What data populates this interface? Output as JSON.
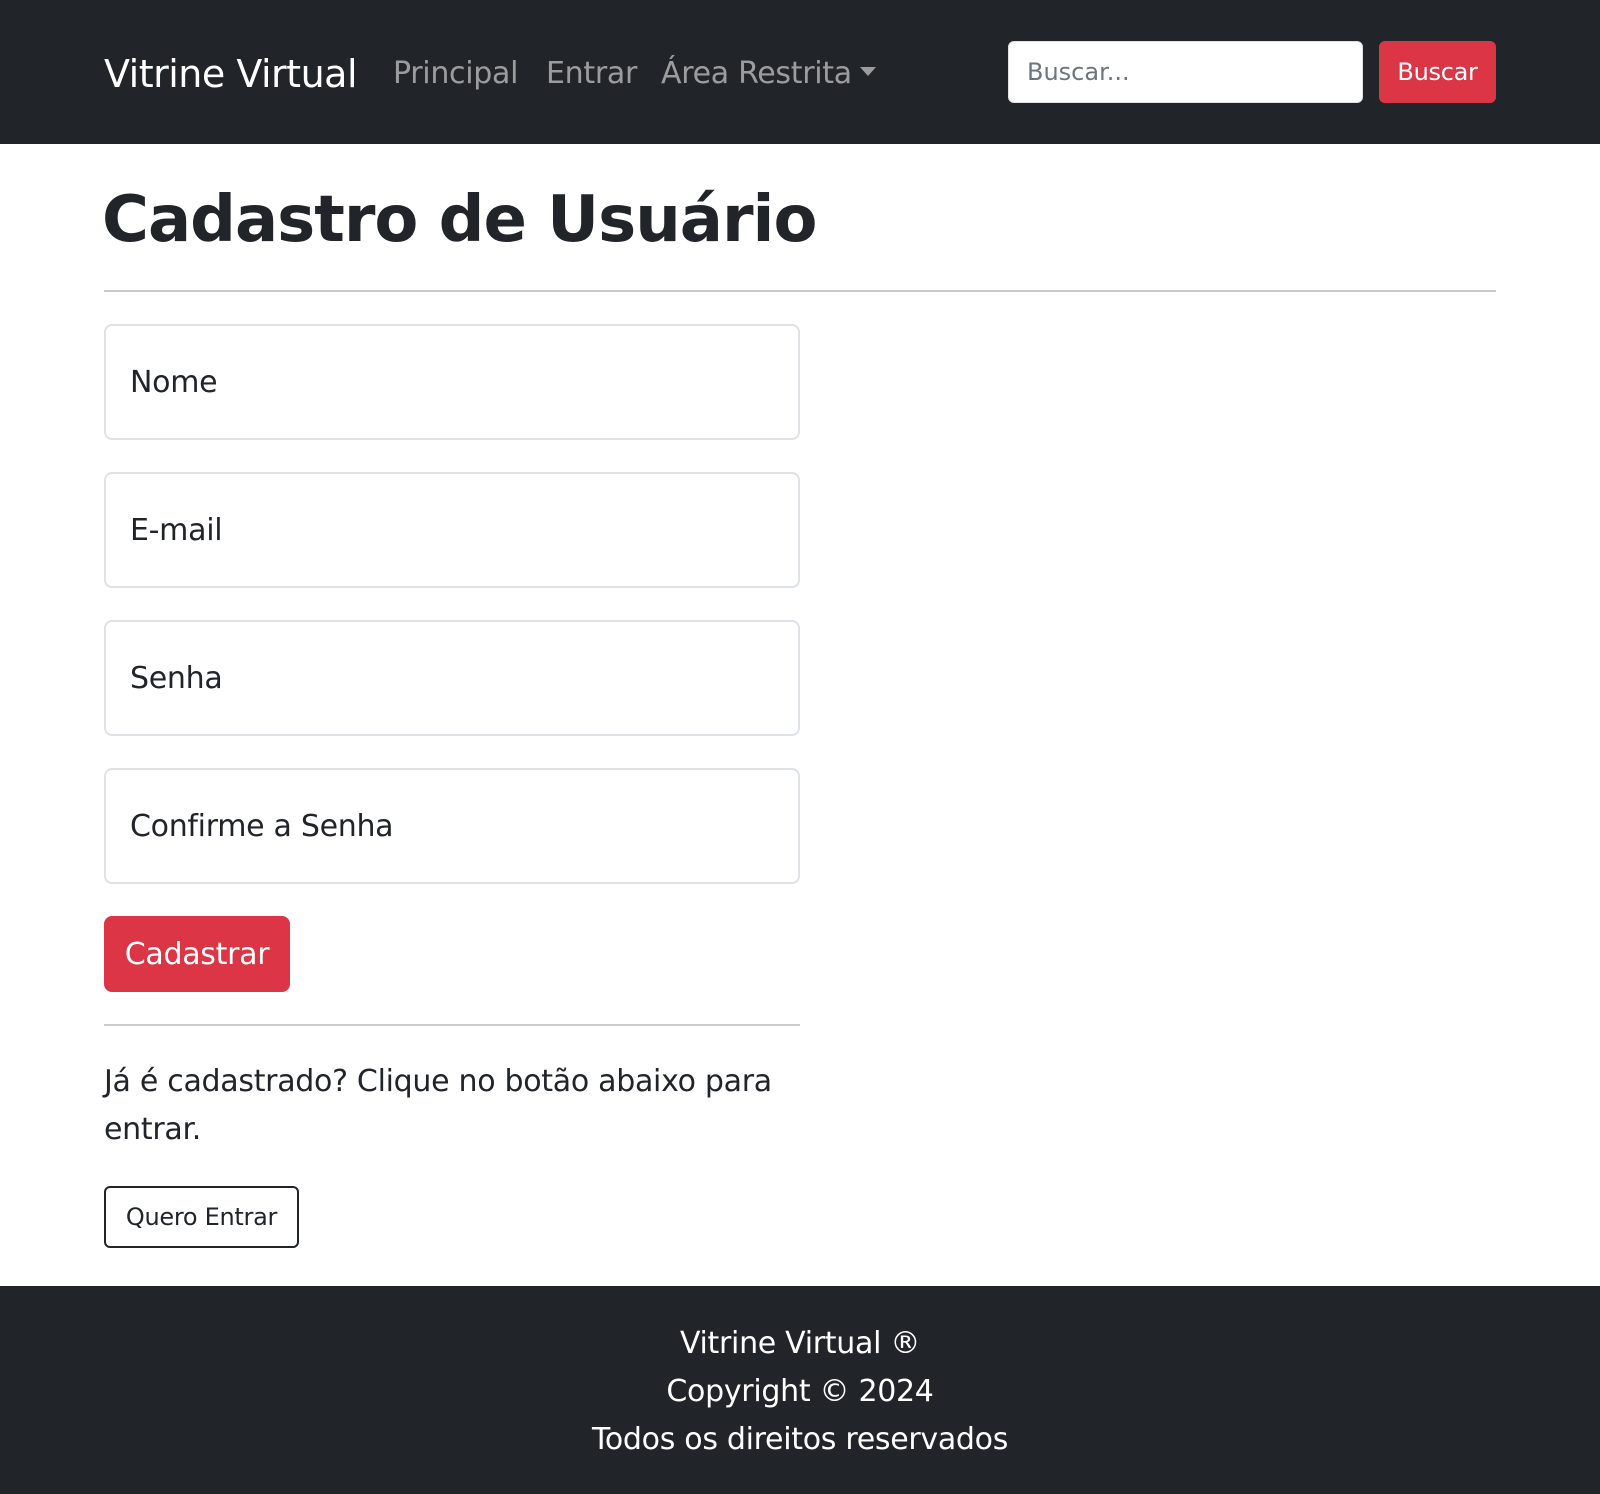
{
  "navbar": {
    "brand": "Vitrine Virtual",
    "links": [
      "Principal",
      "Entrar",
      "Área Restrita"
    ],
    "search_placeholder": "Buscar...",
    "search_button": "Buscar"
  },
  "main": {
    "title": "Cadastro de Usuário",
    "fields": {
      "nome": "Nome",
      "email": "E-mail",
      "senha": "Senha",
      "confirm": "Confirme a Senha"
    },
    "submit_label": "Cadastrar",
    "login_prompt": "Já é cadastrado? Clique no botão abaixo para entrar.",
    "login_button": "Quero Entrar"
  },
  "footer": {
    "line1": "Vitrine Virtual ®",
    "line2": "Copyright © 2024",
    "line3": "Todos os direitos reservados"
  },
  "colors": {
    "navbar_bg": "#212529",
    "accent": "#dc3545",
    "text": "#212529"
  }
}
